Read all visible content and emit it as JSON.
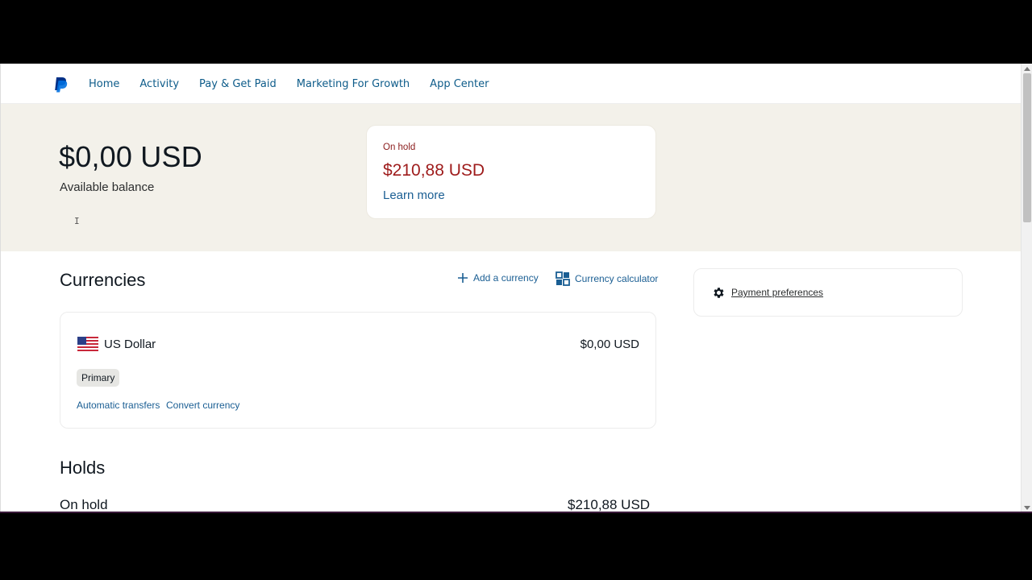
{
  "nav": {
    "logo_icon": "paypal-logo-icon",
    "items": [
      {
        "label": "Home"
      },
      {
        "label": "Activity"
      },
      {
        "label": "Pay & Get Paid"
      },
      {
        "label": "Marketing For Growth"
      },
      {
        "label": "App Center"
      }
    ]
  },
  "balance": {
    "amount": "$0,00 USD",
    "label": "Available balance"
  },
  "hold_card": {
    "label": "On hold",
    "amount": "$210,88 USD",
    "link": "Learn more"
  },
  "currencies": {
    "title": "Currencies",
    "add_currency": "Add a currency",
    "calculator": "Currency calculator",
    "items": [
      {
        "flag": "us-flag-icon",
        "name": "US Dollar",
        "balance": "$0,00 USD",
        "badge": "Primary",
        "link_auto": "Automatic transfers",
        "link_convert": "Convert currency"
      }
    ]
  },
  "preferences": {
    "icon": "gear-icon",
    "label": "Payment preferences"
  },
  "holds": {
    "title": "Holds",
    "row_label": "On hold",
    "row_amount": "$210,88 USD"
  },
  "colors": {
    "link": "#1a5e93",
    "nav_link": "#0e5c8a",
    "hold_red": "#9e1b1b",
    "band_bg": "#f3f1ea"
  }
}
